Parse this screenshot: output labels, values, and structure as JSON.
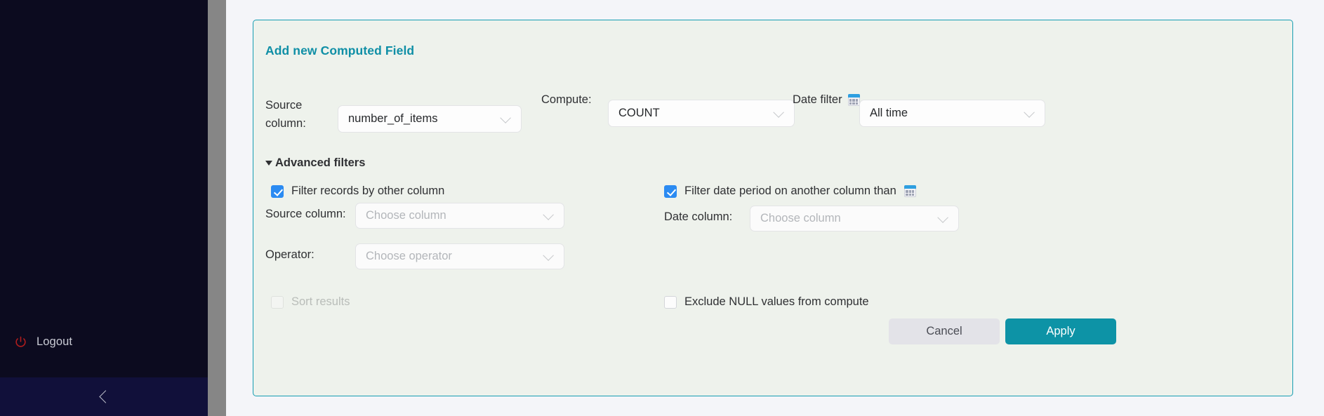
{
  "sidebar": {
    "logout_label": "Logout",
    "logout_icon": "power-icon",
    "collapse_icon": "chevron-left-icon",
    "background_color": "#0c0b1f",
    "logout_icon_color": "#b21d1d"
  },
  "card": {
    "title": "Add new Computed Field",
    "accent_color": "#159db2",
    "background_color": "#eef2ec"
  },
  "primary_row": {
    "source_column_label": "Source column:",
    "source_column_value": "number_of_items",
    "compute_label": "Compute:",
    "compute_value": "COUNT",
    "date_filter_label": "Date filter",
    "date_filter_icon": "calendar-icon",
    "date_filter_value": "All time"
  },
  "advanced": {
    "toggle_label": "Advanced filters",
    "toggle_icon": "triangle-down-icon",
    "expanded": true,
    "filter_records_checkbox": {
      "label": "Filter records by other column",
      "checked": true
    },
    "filter_date_period_checkbox": {
      "label": "Filter date period on another column than",
      "icon": "calendar-icon",
      "checked": true
    },
    "source_column_label": "Source column:",
    "source_column_placeholder": "Choose column",
    "operator_label": "Operator:",
    "operator_placeholder": "Choose operator",
    "date_column_label": "Date column:",
    "date_column_placeholder": "Choose column",
    "sort_results_checkbox": {
      "label": "Sort results",
      "checked": false,
      "disabled": true
    },
    "exclude_null_checkbox": {
      "label": "Exclude NULL values from compute",
      "checked": false
    }
  },
  "footer": {
    "cancel_label": "Cancel",
    "apply_label": "Apply",
    "apply_color": "#0d93a6",
    "cancel_color": "#e3e3e8"
  }
}
